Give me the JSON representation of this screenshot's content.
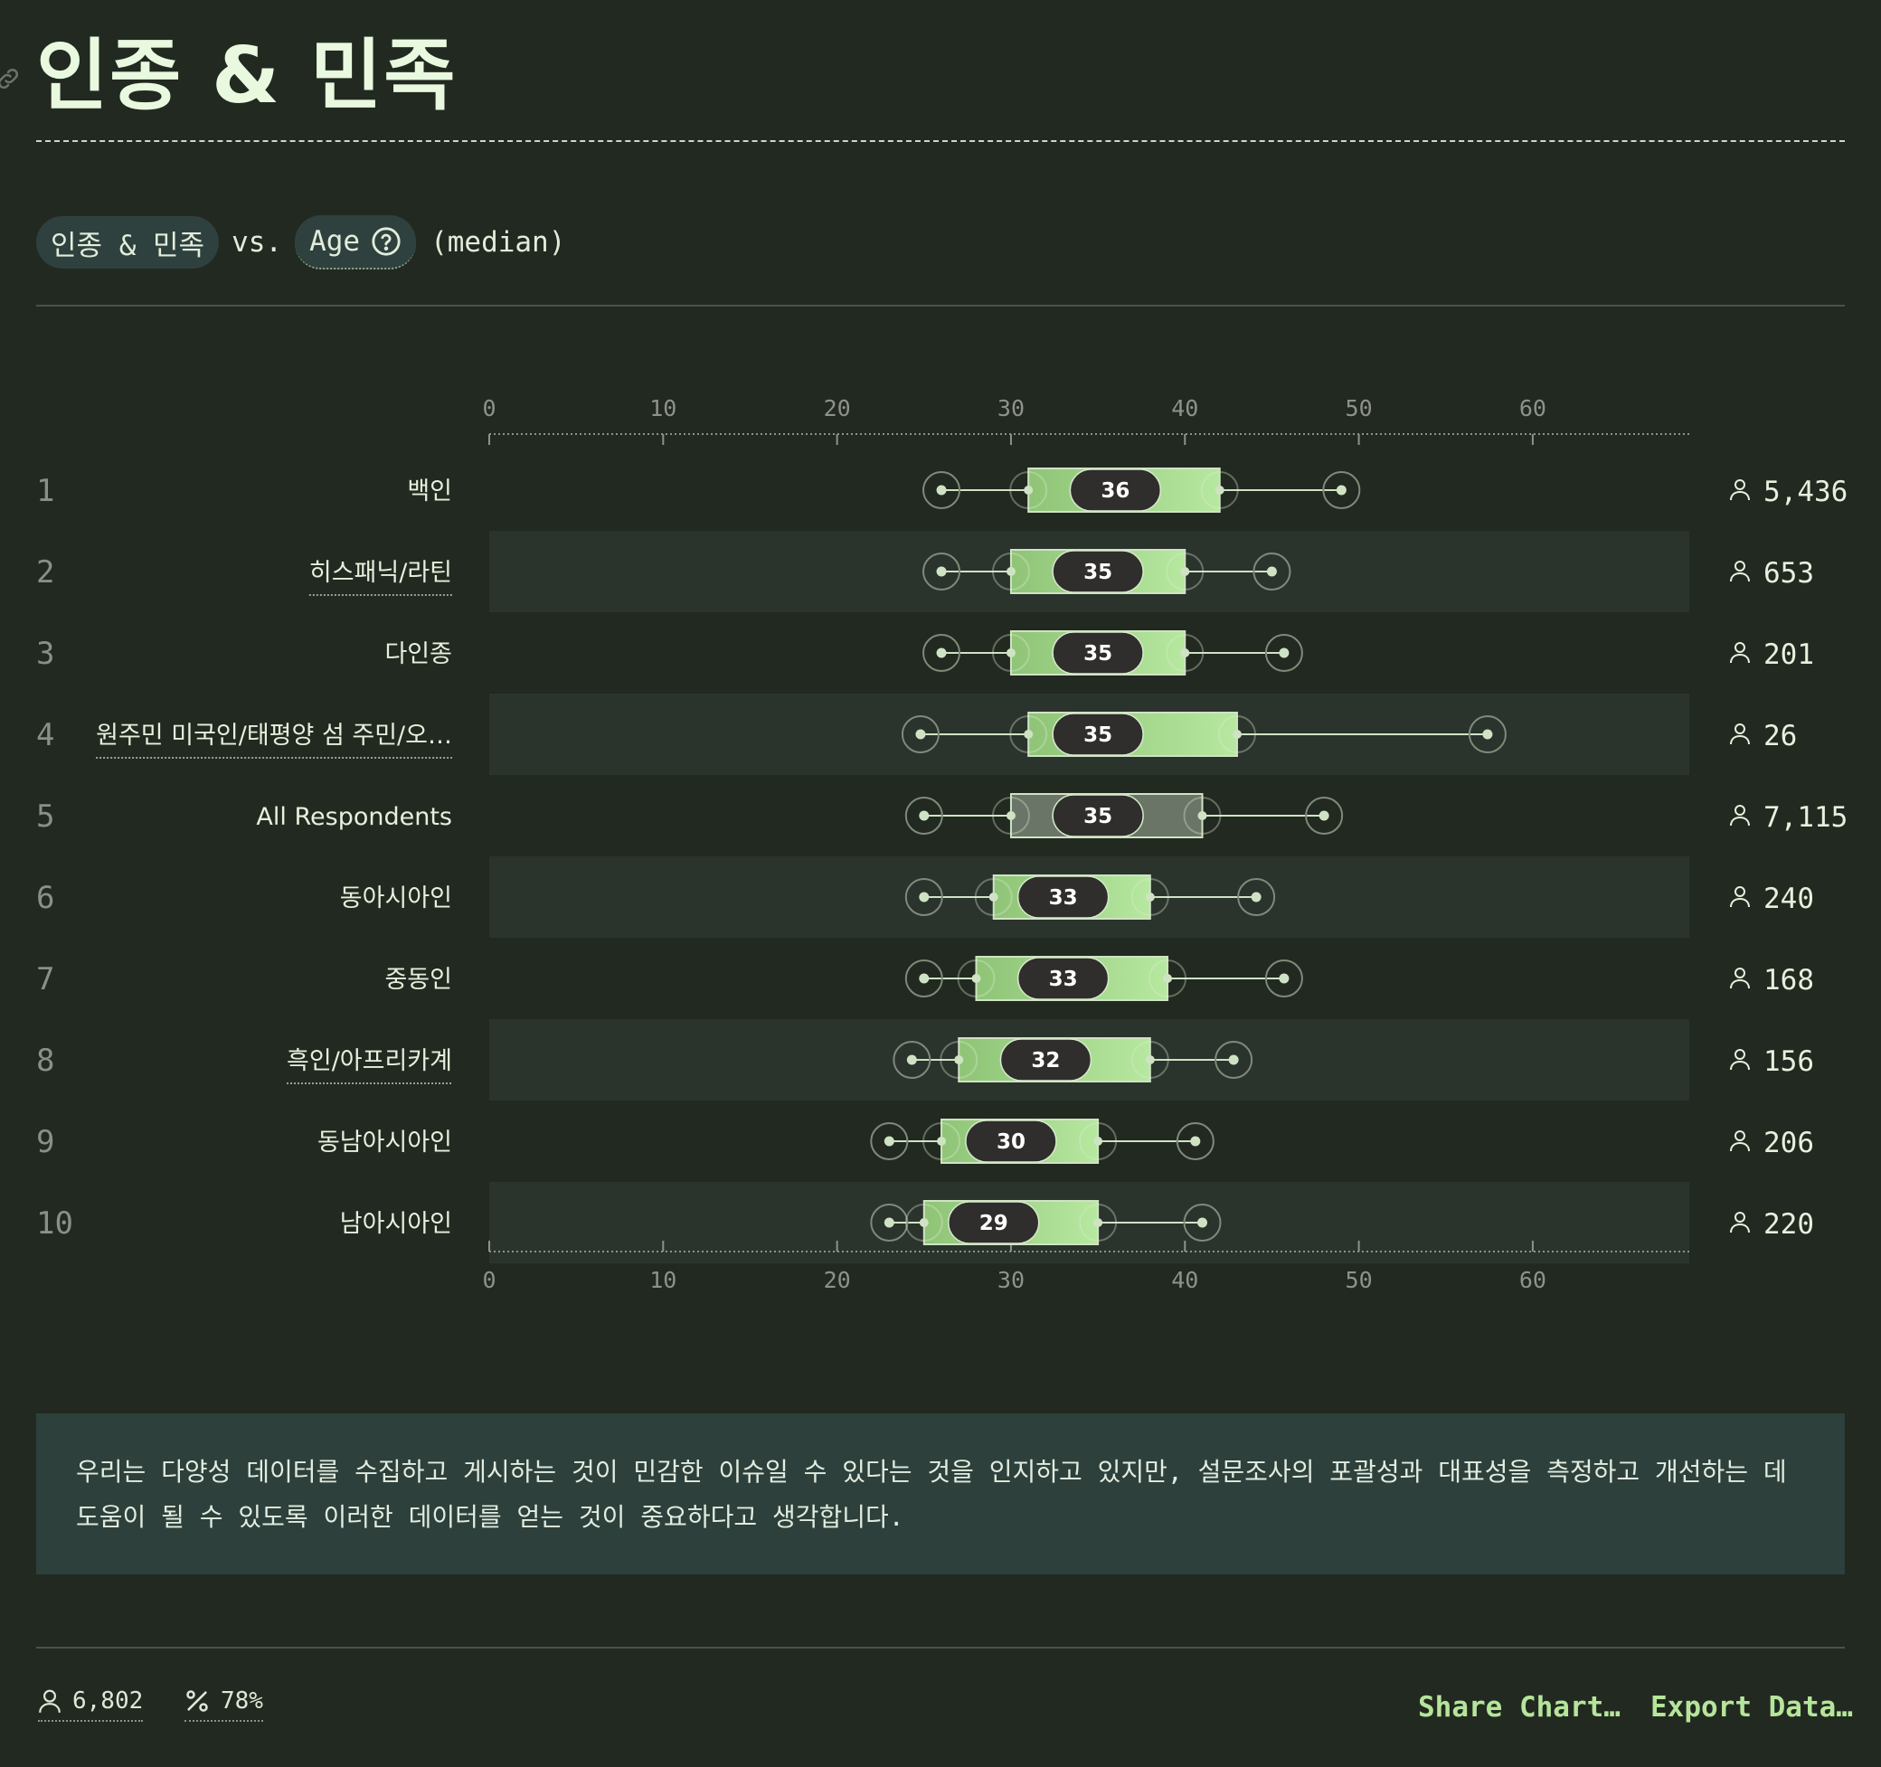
{
  "page": {
    "title": "인종 & 민족",
    "subtitle": {
      "left": "인종 & 민족",
      "vs": "vs.",
      "right": "Age",
      "suffix": "(median)"
    }
  },
  "note": "우리는 다양성 데이터를 수집하고 게시하는 것이 민감한 이슈일 수 있다는 것을 인지하고 있지만, 설문조사의 포괄성과 대표성을 측정하고 개선하는 데 도움이 될 수 있도록 이러한 데이터를 얻는 것이 중요하다고 생각합니다.",
  "footer": {
    "respondents": "6,802",
    "percent": "78%",
    "share_label": "Share Chart…",
    "export_label": "Export Data…"
  },
  "colors": {
    "box_start": "#8fc477",
    "box_end": "#b6e89f",
    "box_all": "#6b7567",
    "median_pill": "#2f2e2c",
    "whisker": "#cfe3c4"
  },
  "chart_data": {
    "type": "boxplot",
    "x_axis": {
      "ticks": [
        0,
        10,
        20,
        30,
        40,
        50,
        60
      ],
      "range": [
        0,
        69
      ]
    },
    "rows": [
      {
        "rank": "1",
        "label": "백인",
        "linked": false,
        "whisker_low": 26,
        "q1": 31,
        "median": 36,
        "q3": 42,
        "whisker_high": 49,
        "count": "5,436"
      },
      {
        "rank": "2",
        "label": "히스패닉/라틴",
        "linked": true,
        "whisker_low": 26,
        "q1": 30,
        "median": 35,
        "q3": 40,
        "whisker_high": 45,
        "count": "653"
      },
      {
        "rank": "3",
        "label": "다인종",
        "linked": false,
        "whisker_low": 26,
        "q1": 30,
        "median": 35,
        "q3": 40,
        "whisker_high": 45.7,
        "count": "201"
      },
      {
        "rank": "4",
        "label": "원주민 미국인/태평양 섬 주민/오…",
        "linked": true,
        "whisker_low": 24.8,
        "q1": 31,
        "median": 35,
        "q3": 43,
        "whisker_high": 57.4,
        "count": "26"
      },
      {
        "rank": "5",
        "label": "All Respondents",
        "linked": false,
        "all": true,
        "whisker_low": 25,
        "q1": 30,
        "median": 35,
        "q3": 41,
        "whisker_high": 48,
        "count": "7,115"
      },
      {
        "rank": "6",
        "label": "동아시아인",
        "linked": false,
        "whisker_low": 25,
        "q1": 29,
        "median": 33,
        "q3": 38,
        "whisker_high": 44.1,
        "count": "240"
      },
      {
        "rank": "7",
        "label": "중동인",
        "linked": false,
        "whisker_low": 25,
        "q1": 28,
        "median": 33,
        "q3": 39,
        "whisker_high": 45.7,
        "count": "168"
      },
      {
        "rank": "8",
        "label": "흑인/아프리카계",
        "linked": true,
        "whisker_low": 24.3,
        "q1": 27,
        "median": 32,
        "q3": 38,
        "whisker_high": 42.8,
        "count": "156"
      },
      {
        "rank": "9",
        "label": "동남아시아인",
        "linked": false,
        "whisker_low": 23,
        "q1": 26,
        "median": 30,
        "q3": 35,
        "whisker_high": 40.6,
        "count": "206"
      },
      {
        "rank": "10",
        "label": "남아시아인",
        "linked": false,
        "whisker_low": 23,
        "q1": 25,
        "median": 29,
        "q3": 35,
        "whisker_high": 41,
        "count": "220"
      }
    ]
  }
}
